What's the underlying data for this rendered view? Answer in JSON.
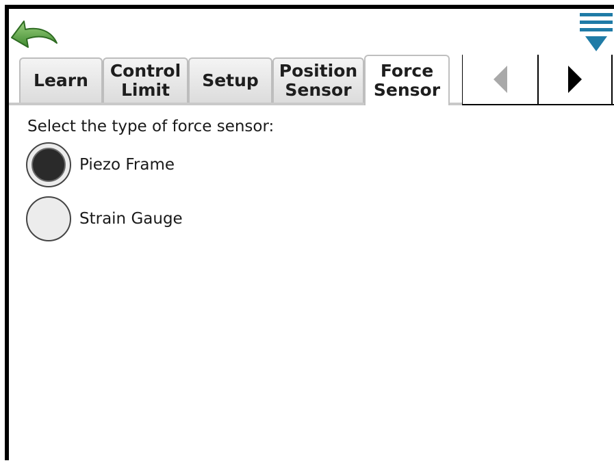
{
  "tabs": [
    {
      "label": "Learn",
      "active": false
    },
    {
      "label": "Control\nLimit",
      "active": false
    },
    {
      "label": "Setup",
      "active": false
    },
    {
      "label": "Position\nSensor",
      "active": false
    },
    {
      "label": "Force\nSensor",
      "active": true
    }
  ],
  "content": {
    "prompt": "Select the type of force sensor:",
    "options": [
      {
        "label": "Piezo Frame",
        "selected": true
      },
      {
        "label": "Strain Gauge",
        "selected": false
      }
    ]
  },
  "icons": {
    "back": "back-arrow-icon",
    "menu": "menu-dropdown-icon",
    "prev": "triangle-left-icon",
    "next": "triangle-right-icon"
  },
  "colors": {
    "back_arrow": "#5fa84a",
    "menu_icon": "#1f7ba6"
  }
}
